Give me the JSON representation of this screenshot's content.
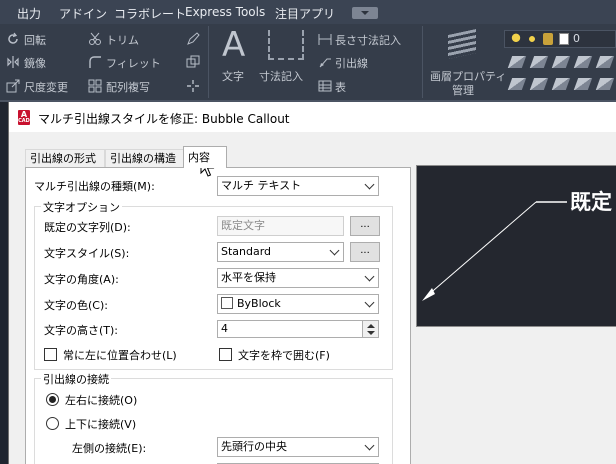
{
  "menubar": {
    "items": [
      "出力",
      "アドイン",
      "コラボレート",
      "Express Tools",
      "注目アプリ"
    ]
  },
  "ribbon": {
    "modify_items": [
      "回転",
      "鏡像",
      "尺度変更"
    ],
    "modify_items_2": [
      "トリム",
      "フィレット",
      "配列複写"
    ],
    "text_label": "文字",
    "dimension_label": "寸法記入",
    "annotation_items": [
      "長さ寸法記入",
      "引出線",
      "表"
    ],
    "layer_props_label": "画層プロパティ",
    "layer_props_label_2": "管理",
    "layer_value": "0"
  },
  "dialog": {
    "title": "マルチ引出線スタイルを修正: Bubble Callout",
    "app_icon_letter": "A",
    "app_icon_sub": "CAD",
    "tabs": [
      {
        "label": "引出線の形式",
        "active": false
      },
      {
        "label": "引出線の構造",
        "active": false
      },
      {
        "label": "内容",
        "active": true
      }
    ],
    "content_type_label": "マルチ引出線の種類(M):",
    "content_type_value": "マルチ テキスト",
    "text_options": {
      "legend": "文字オプション",
      "default_text_label": "既定の文字列(D):",
      "default_text_value": "既定文字",
      "browse_label": "...",
      "text_style_label": "文字スタイル(S):",
      "text_style_value": "Standard",
      "text_style_browse": "...",
      "text_angle_label": "文字の角度(A):",
      "text_angle_value": "水平を保持",
      "text_color_label": "文字の色(C):",
      "text_color_value": "ByBlock",
      "text_height_label": "文字の高さ(T):",
      "text_height_value": "4",
      "always_left_label": "常に左に位置合わせ(L)",
      "always_left_checked": false,
      "frame_label": "文字を枠で囲む(F)",
      "frame_checked": false
    },
    "leader_connection": {
      "legend": "引出線の接続",
      "horizontal_label": "左右に接続(O)",
      "horizontal_selected": true,
      "vertical_label": "上下に接続(V)",
      "vertical_selected": false,
      "left_attach_label": "左側の接続(E):",
      "left_attach_value": "先頭行の中央"
    },
    "preview": {
      "text": "既定"
    }
  }
}
